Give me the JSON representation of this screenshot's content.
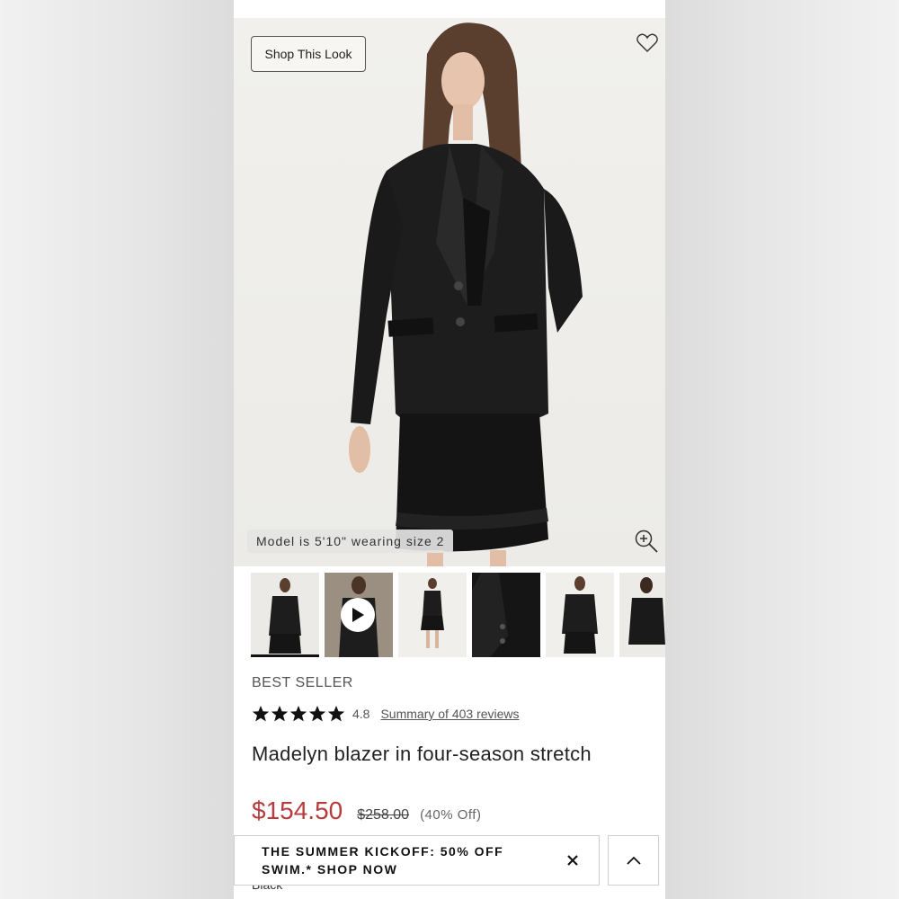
{
  "hero": {
    "shop_look_label": "Shop This Look",
    "model_note": "Model is 5'10\" wearing size 2",
    "icons": [
      "heart-icon",
      "zoom-in-icon"
    ]
  },
  "thumbnails": [
    {
      "name": "thumb-front-full",
      "active": true
    },
    {
      "name": "thumb-video",
      "icon": "play-icon"
    },
    {
      "name": "thumb-full-length"
    },
    {
      "name": "thumb-detail"
    },
    {
      "name": "thumb-back"
    },
    {
      "name": "thumb-styled"
    }
  ],
  "product": {
    "badge": "BEST SELLER",
    "rating": "4.8",
    "rating_stars": 5,
    "reviews_link": "Summary of 403 reviews",
    "title": "Madelyn blazer in four-season stretch",
    "price_sale": "$154.50",
    "price_original": "$258.00",
    "price_off": "(40% Off)",
    "color": "Black"
  },
  "promo": {
    "line1": "THE SUMMER KICKOFF: 50% OFF",
    "line2": "SWIM.* SHOP NOW",
    "close_icon": "close-icon",
    "up_icon": "chevron-up-icon"
  },
  "colors": {
    "sale_price": "#b83a3a",
    "text": "#222222"
  }
}
